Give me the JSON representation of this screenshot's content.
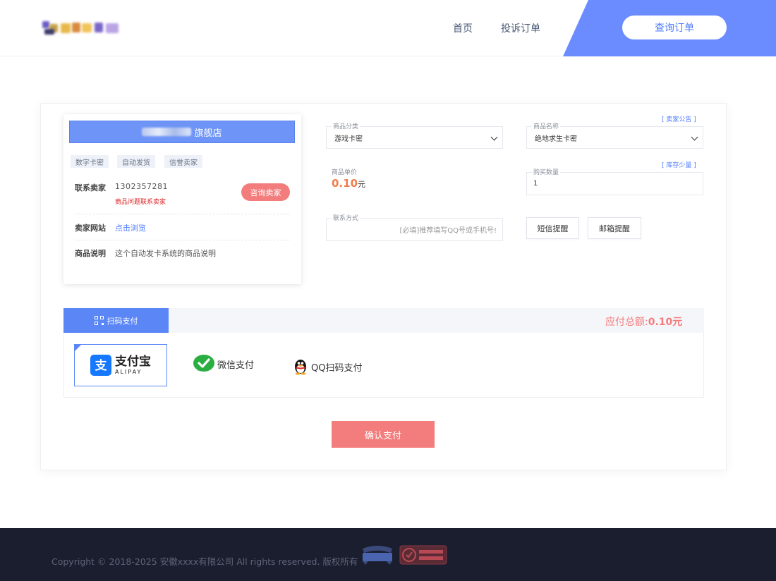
{
  "header": {
    "nav_home": "首页",
    "nav_complaint": "投诉订单",
    "query_order_btn": "查询订单"
  },
  "shop": {
    "title_suffix": "旗舰店",
    "tags": [
      "数字卡密",
      "自动发货",
      "信誉卖家"
    ],
    "contact_label": "联系卖家",
    "contact_phone": "1302357281",
    "contact_warning": "商品问题联系卖家",
    "consult_btn": "咨询卖家",
    "website_label": "卖家网站",
    "website_link": "点击浏览",
    "desc_label": "商品说明",
    "desc_value": "这个自动发卡系统的商品说明"
  },
  "form": {
    "category_label": "商品分类",
    "category_value": "游戏卡密",
    "name_label": "商品名称",
    "name_value": "绝地求生卡密",
    "seller_notice": "[ 卖家公告 ]",
    "stock_notice": "[ 库存少量 ]",
    "price_label": "商品单价",
    "price_value": "0.10",
    "price_unit": "元",
    "qty_label": "购买数量",
    "qty_value": "1",
    "contact_label": "联系方式",
    "contact_placeholder": "[必填]推荐填写QQ号或手机号!",
    "sms_btn": "短信提醒",
    "email_btn": "邮箱提醒"
  },
  "payment": {
    "tab_label": "扫码支付",
    "total_label": "应付总额:",
    "total_value": "0.10元",
    "alipay_cn": "支付宝",
    "alipay_en": "ALIPAY",
    "wechat_label": "微信支付",
    "qq_label": "QQ扫码支付",
    "confirm_btn": "确认支付"
  },
  "footer": {
    "copyright": "Copyright © 2018-2025 安徽xxxx有限公司 All rights reserved. 版权所有"
  },
  "colors": {
    "accent_blue": "#5b86f6",
    "accent_red": "#f37c7c",
    "price_orange": "#f37c4a",
    "footer_bg": "#1b1e2f"
  },
  "icons": [
    "qr-code-icon",
    "alipay-logo-icon",
    "wechat-icon",
    "qq-penguin-icon",
    "chevron-down-icon"
  ]
}
